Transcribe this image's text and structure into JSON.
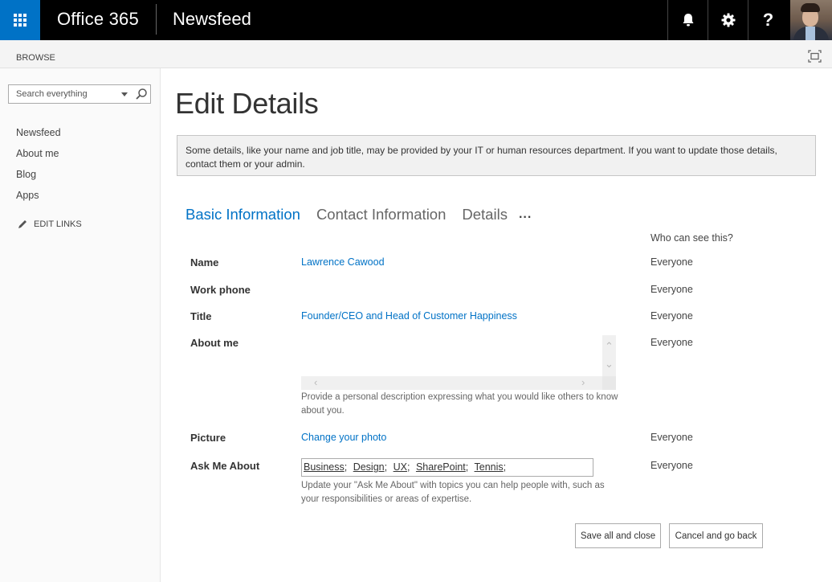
{
  "suitebar": {
    "brand": "Office 365",
    "app_title": "Newsfeed",
    "icons": [
      "app-launcher-icon",
      "bell-icon",
      "gear-icon",
      "help-icon"
    ],
    "help_glyph": "?",
    "accent_color": "#0072c6"
  },
  "ribbon": {
    "browse_label": "BROWSE",
    "focus_icon": "focus-on-content-icon"
  },
  "sidebar": {
    "search_placeholder": "Search everything",
    "nav": [
      {
        "label": "Newsfeed"
      },
      {
        "label": "About me"
      },
      {
        "label": "Blog"
      },
      {
        "label": "Apps"
      }
    ],
    "edit_links_label": "EDIT LINKS"
  },
  "main": {
    "title": "Edit Details",
    "notice": "Some details, like your name and job title, may be provided by your IT or human resources department. If you want to update those details, contact them or your admin.",
    "tabs": [
      {
        "label": "Basic Information",
        "active": true
      },
      {
        "label": "Contact Information",
        "active": false
      },
      {
        "label": "Details",
        "active": false
      }
    ],
    "tabs_more": "...",
    "who_can_see_header": "Who can see this?",
    "fields": {
      "name": {
        "label": "Name",
        "value": "Lawrence Cawood",
        "visibility": "Everyone"
      },
      "work_phone": {
        "label": "Work phone",
        "value": "",
        "visibility": "Everyone"
      },
      "title": {
        "label": "Title",
        "value": "Founder/CEO and Head of Customer Happiness",
        "visibility": "Everyone"
      },
      "about_me": {
        "label": "About me",
        "value": "",
        "hint": "Provide a personal description expressing what you would like others to know about you.",
        "visibility": "Everyone"
      },
      "picture": {
        "label": "Picture",
        "value": "Change your photo",
        "visibility": "Everyone"
      },
      "ask_me_about": {
        "label": "Ask Me About",
        "tags": [
          "Business",
          "Design",
          "UX",
          "SharePoint",
          "Tennis"
        ],
        "hint": "Update your \"Ask Me About\" with topics you can help people with, such as your responsibilities or areas of expertise.",
        "visibility": "Everyone"
      }
    },
    "buttons": {
      "save": "Save all and close",
      "cancel": "Cancel and go back"
    }
  }
}
